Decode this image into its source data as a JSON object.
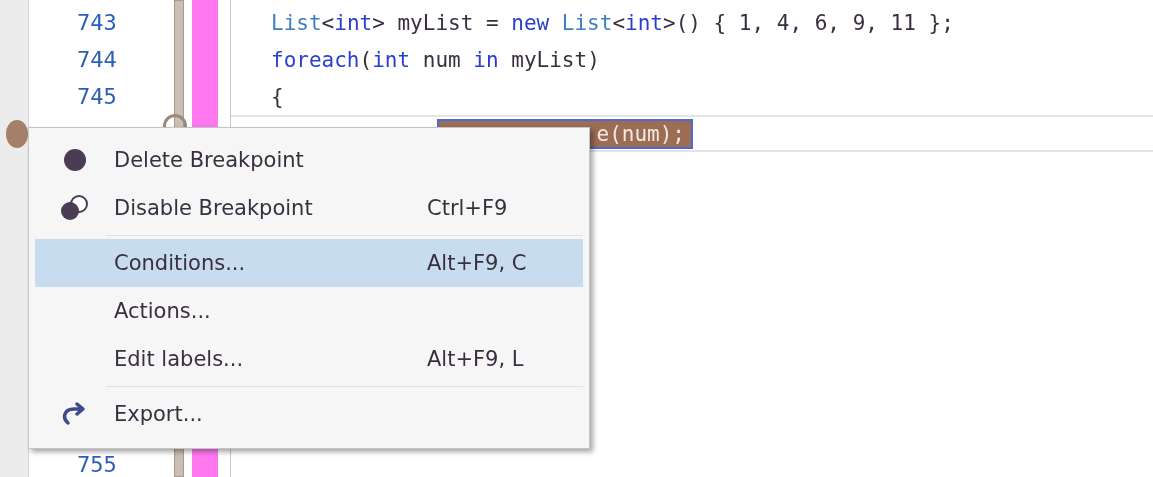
{
  "editor": {
    "lines": [
      {
        "number": "743",
        "current": false,
        "tokens": [
          {
            "kind": "type",
            "text": "List"
          },
          {
            "kind": "plain",
            "text": "<"
          },
          {
            "kind": "keyword",
            "text": "int"
          },
          {
            "kind": "plain",
            "text": "> myList = "
          },
          {
            "kind": "keyword",
            "text": "new"
          },
          {
            "kind": "type",
            "text": " List"
          },
          {
            "kind": "plain",
            "text": "<"
          },
          {
            "kind": "keyword",
            "text": "int"
          },
          {
            "kind": "plain",
            "text": ">() { 1, 4, 6, 9, 11 };"
          }
        ]
      },
      {
        "number": "744",
        "current": false,
        "tokens": [
          {
            "kind": "keyword",
            "text": "foreach"
          },
          {
            "kind": "plain",
            "text": "("
          },
          {
            "kind": "keyword",
            "text": "int"
          },
          {
            "kind": "plain",
            "text": " num "
          },
          {
            "kind": "keyword",
            "text": "in"
          },
          {
            "kind": "plain",
            "text": " myList)"
          }
        ]
      },
      {
        "number": "745",
        "current": false,
        "tokens": [
          {
            "kind": "plain",
            "text": "{"
          }
        ]
      },
      {
        "current": true,
        "breakpoint": true,
        "tokens": [
          {
            "kind": "breakpoint",
            "text": "e(num);"
          }
        ]
      }
    ],
    "last_line": {
      "number": "755"
    }
  },
  "context_menu": {
    "items": [
      {
        "kind": "delete",
        "label": "Delete Breakpoint",
        "selected": false
      },
      {
        "kind": "disable",
        "label": "Disable Breakpoint",
        "shortcut": "Ctrl+F9",
        "selected": false
      },
      {
        "kind": "separator"
      },
      {
        "kind": "item",
        "label": "Conditions...",
        "shortcut": "Alt+F9, C",
        "selected": true
      },
      {
        "kind": "item",
        "label": "Actions...",
        "selected": false
      },
      {
        "kind": "item",
        "label": "Edit labels...",
        "shortcut": "Alt+F9, L",
        "selected": false
      },
      {
        "kind": "separator"
      },
      {
        "kind": "export",
        "label": "Export...",
        "selected": false
      }
    ]
  }
}
